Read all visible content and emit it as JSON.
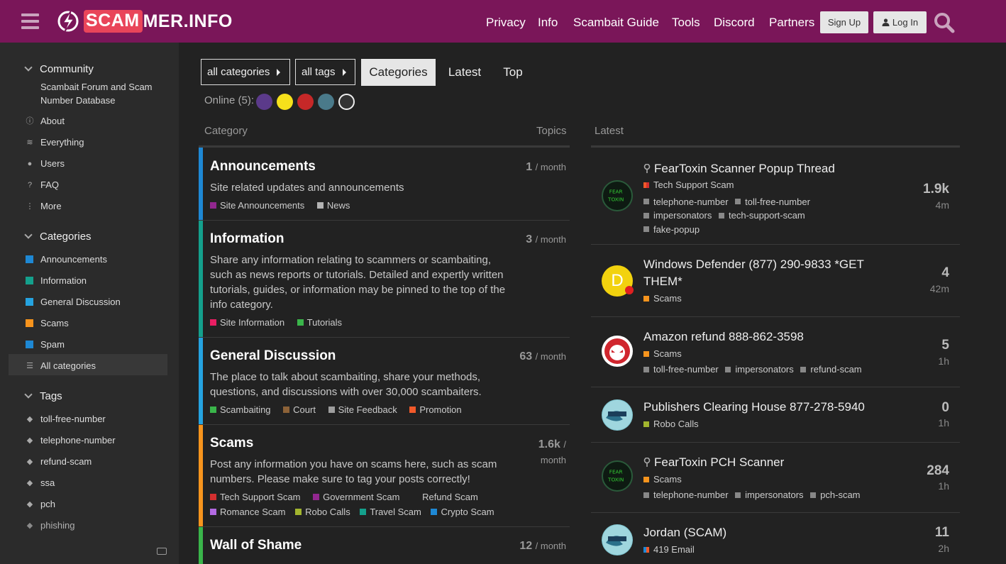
{
  "header": {
    "brand_a": "SCAM",
    "brand_b": "MER.INFO",
    "nav": [
      "Privacy",
      "Info",
      "Scambait Guide",
      "Tools",
      "Discord",
      "Partners"
    ],
    "signup": "Sign Up",
    "login": "Log In",
    "bg_color": "#7a1659"
  },
  "sidebar": {
    "community": {
      "title": "Community",
      "subtitle": "Scambait Forum and Scam Number Database",
      "items": [
        {
          "label": "About",
          "icon": "info-icon"
        },
        {
          "label": "Everything",
          "icon": "layers-icon"
        },
        {
          "label": "Users",
          "icon": "users-icon"
        },
        {
          "label": "FAQ",
          "icon": "question-icon"
        },
        {
          "label": "More",
          "icon": "more-vertical-icon"
        }
      ]
    },
    "categories": {
      "title": "Categories",
      "items": [
        {
          "label": "Announcements",
          "color": "#1e88d4"
        },
        {
          "label": "Information",
          "color": "#14a08c"
        },
        {
          "label": "General Discussion",
          "color": "#25a3e0"
        },
        {
          "label": "Scams",
          "color": "#f7941d"
        },
        {
          "label": "Spam",
          "color": "#1e88d4"
        }
      ],
      "all": "All categories"
    },
    "tags": {
      "title": "Tags",
      "items": [
        "toll-free-number",
        "telephone-number",
        "refund-scam",
        "ssa",
        "pch",
        "phishing"
      ]
    }
  },
  "filters": {
    "all_categories": "all categories",
    "all_tags": "all tags",
    "tabs": [
      "Categories",
      "Latest",
      "Top"
    ]
  },
  "online": {
    "label": "Online (5):"
  },
  "columns": {
    "category": "Category",
    "topics": "Topics",
    "latest": "Latest"
  },
  "categories": [
    {
      "name": "Announcements",
      "color": "#1e88d4",
      "desc": "Site related updates and announcements",
      "count": "1",
      "period": "/ month",
      "subs": [
        {
          "label": "Site Announcements",
          "color": "#92278f"
        },
        {
          "label": "News",
          "color": "#b3b3b3"
        }
      ]
    },
    {
      "name": "Information",
      "color": "#14a08c",
      "desc": "Share any information relating to scammers or scambaiting, such as news reports or tutorials. Detailed and expertly written tutorials, guides, or information may be pinned to the top of the info category.",
      "count": "3",
      "period": "/ month",
      "subs": [
        {
          "label": "Site Information",
          "color": "#e91e63"
        },
        {
          "label": "Tutorials",
          "color": "#3ab54a"
        }
      ]
    },
    {
      "name": "General Discussion",
      "color": "#25a3e0",
      "desc": "The place to talk about scambaiting, share your methods, questions, and discussions with over 30,000 scambaiters.",
      "count": "63",
      "period": "/ month",
      "subs": [
        {
          "label": "Scambaiting",
          "color": "#3ab54a"
        },
        {
          "label": "Court",
          "color": "#8c6238"
        },
        {
          "label": "Site Feedback",
          "color": "#9e9e9e"
        },
        {
          "label": "Promotion",
          "color": "#f1592a"
        }
      ]
    },
    {
      "name": "Scams",
      "color": "#f7941d",
      "desc": "Post any information you have on scams here, such as scam numbers. Please make sure to tag your posts correctly!",
      "count": "1.6k",
      "period": "/",
      "period2": "month",
      "subs": [
        {
          "label": "Tech Support Scam",
          "color": "#d32f2f"
        },
        {
          "label": "Government Scam",
          "color": "#92278f"
        },
        {
          "label": "Refund Scam",
          "color": "transparent"
        }
      ],
      "subs2": [
        {
          "label": "Romance Scam",
          "color": "#b36ae2"
        },
        {
          "label": "Robo Calls",
          "color": "#a2b52e"
        },
        {
          "label": "Travel Scam",
          "color": "#14a08c"
        },
        {
          "label": "Crypto Scam",
          "color": "#1e88d4"
        }
      ]
    },
    {
      "name": "Wall of Shame",
      "color": "#3ab54a",
      "desc": "",
      "count": "12",
      "period": "/ month",
      "subs": []
    }
  ],
  "latest": [
    {
      "title": "FearToxin Scanner Popup Thread",
      "pinned": true,
      "category": "Tech Support Scam",
      "cat_color": "#d32f2f",
      "tags": [
        "telephone-number",
        "toll-free-number",
        "impersonators",
        "tech-support-scam",
        "fake-popup"
      ],
      "count": "1.9k",
      "age": "4m",
      "avatar": "fear-toxin-avatar"
    },
    {
      "title": "Windows Defender (877) 290-9833 *GET THEM*",
      "pinned": false,
      "category": "Scams",
      "cat_color": "#f7941d",
      "tags": [],
      "count": "4",
      "age": "42m",
      "avatar": "letter-d-avatar",
      "avatar_letter": "D"
    },
    {
      "title": "Amazon refund 888-862-3598",
      "pinned": false,
      "category": "Scams",
      "cat_color": "#f7941d",
      "tags": [
        "toll-free-number",
        "impersonators",
        "refund-scam"
      ],
      "count": "5",
      "age": "1h",
      "avatar": "devil-avatar"
    },
    {
      "title": "Publishers Clearing House 877-278-5940",
      "pinned": false,
      "category": "Robo Calls",
      "cat_color": "#a2b52e",
      "tags": [],
      "count": "0",
      "age": "1h",
      "avatar": "tsunami-avatar"
    },
    {
      "title": "FearToxin PCH Scanner",
      "pinned": true,
      "category": "Scams",
      "cat_color": "#f7941d",
      "tags": [
        "telephone-number",
        "impersonators",
        "pch-scam"
      ],
      "count": "284",
      "age": "1h",
      "avatar": "fear-toxin-avatar"
    },
    {
      "title": "Jordan (SCAM)",
      "pinned": false,
      "category": "419 Email",
      "cat_color": "#1e88d4",
      "tags": [],
      "count": "11",
      "age": "2h",
      "avatar": "tsunami-avatar"
    }
  ],
  "colors": {
    "background": "#222222",
    "sidebar": "#2b2b2b"
  }
}
